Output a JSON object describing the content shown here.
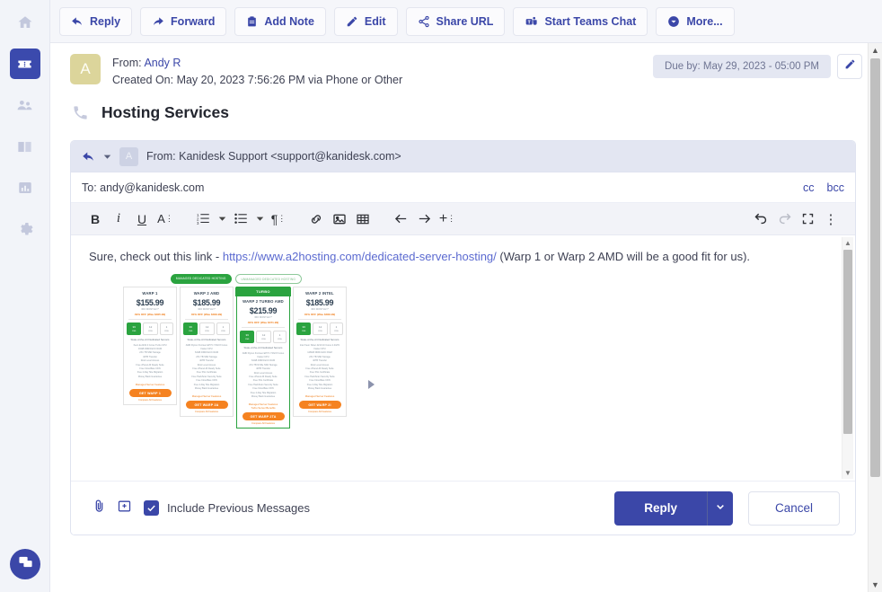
{
  "sidebar": {
    "items": [
      {
        "name": "home",
        "icon": "home-icon",
        "active": false
      },
      {
        "name": "tickets",
        "icon": "ticket-icon",
        "active": true
      },
      {
        "name": "contacts",
        "icon": "people-icon",
        "active": false
      },
      {
        "name": "knowledge-base",
        "icon": "book-icon",
        "active": false
      },
      {
        "name": "reports",
        "icon": "bar-chart-icon",
        "active": false
      },
      {
        "name": "settings",
        "icon": "gear-icon",
        "active": false
      }
    ],
    "fab": {
      "name": "chat-fab",
      "icon": "chat-bubble-icon"
    }
  },
  "toolbar": {
    "buttons": [
      {
        "label": "Reply",
        "icon": "reply-arrow-icon"
      },
      {
        "label": "Forward",
        "icon": "forward-arrow-icon"
      },
      {
        "label": "Add Note",
        "icon": "clipboard-icon"
      },
      {
        "label": "Edit",
        "icon": "pencil-icon"
      },
      {
        "label": "Share URL",
        "icon": "share-icon"
      },
      {
        "label": "Start Teams Chat",
        "icon": "teams-icon"
      },
      {
        "label": "More...",
        "icon": "circle-chevron-down-icon"
      }
    ]
  },
  "ticket": {
    "avatar_initial": "A",
    "from_label": "From:",
    "from_name": "Andy R",
    "created_line": "Created On: May 20, 2023 7:56:26 PM via Phone or Other",
    "due_pill": "Due by: May 29, 2023 - 05:00 PM",
    "due_edit_icon": "pencil-icon",
    "subject_icon": "phone-icon",
    "subject": "Hosting Services"
  },
  "reply": {
    "header": {
      "reply_icon": "reply-arrow-icon",
      "caret_icon": "caret-down-icon",
      "avatar_initial": "A",
      "from": "From: Kanidesk Support <support@kanidesk.com>"
    },
    "to_line": "To: andy@kanidesk.com",
    "cc_label": "cc",
    "bcc_label": "bcc",
    "editor_toolbar": [
      {
        "name": "bold-button",
        "glyph": "B",
        "dim": false
      },
      {
        "name": "italic-button",
        "glyph": "i",
        "dim": false
      },
      {
        "name": "underline-button",
        "glyph": "U",
        "dim": false
      },
      {
        "name": "font-style-button",
        "glyph": "A⋮",
        "dim": false
      },
      {
        "name": "ordered-list-button",
        "glyph": "ol",
        "dim": false
      },
      {
        "name": "ordered-list-caret",
        "glyph": "▾",
        "dim": false
      },
      {
        "name": "unordered-list-button",
        "glyph": "ul",
        "dim": false
      },
      {
        "name": "unordered-list-caret",
        "glyph": "▾",
        "dim": false
      },
      {
        "name": "paragraph-button",
        "glyph": "¶⋮",
        "dim": false
      },
      {
        "name": "link-button",
        "glyph": "link",
        "dim": false
      },
      {
        "name": "insert-image-button",
        "glyph": "image",
        "dim": false
      },
      {
        "name": "insert-table-button",
        "glyph": "table",
        "dim": false
      },
      {
        "name": "outdent-button",
        "glyph": "←",
        "dim": false
      },
      {
        "name": "indent-button",
        "glyph": "→",
        "dim": false
      },
      {
        "name": "insert-more-button",
        "glyph": "+⋮",
        "dim": false
      },
      {
        "name": "undo-button",
        "glyph": "undo",
        "dim": false
      },
      {
        "name": "redo-button",
        "glyph": "redo",
        "dim": true
      },
      {
        "name": "fullscreen-button",
        "glyph": "expand",
        "dim": false
      },
      {
        "name": "overflow-menu-button",
        "glyph": "⋮",
        "dim": false
      }
    ],
    "body": {
      "text_before": "Sure, check out this link - ",
      "link": "https://www.a2hosting.com/dedicated-server-hosting/",
      "text_after": " (Warp 1 or Warp 2 AMD will be a good fit for us)."
    },
    "footer": {
      "attach_icon": "paperclip-icon",
      "insert_icon": "insert-image-plus-icon",
      "checkbox_checked": true,
      "checkbox_label": "Include Previous Messages",
      "reply_label": "Reply",
      "reply_split_icon": "chevron-down-icon",
      "cancel_label": "Cancel"
    }
  },
  "embedded_image": {
    "name": "a2hosting-pricing-screenshot",
    "toggle_pills": [
      {
        "label": "MANAGED DEDICATED HOSTING",
        "selected": true
      },
      {
        "label": "UNMANAGED DEDICATED HOSTING",
        "selected": false
      }
    ],
    "turbo_badge": "TURBO",
    "plans": [
      {
        "name": "WARP 1",
        "price": "$155.99",
        "per": "/MO MONTHLY*",
        "save": "49% OFF (Was $305.99)",
        "terms": [
          "36 mo",
          "12 mo",
          "1 mo"
        ],
        "selected_term": 0,
        "highlight": false,
        "tagline": "State-of-the-Art Dedicated Servers",
        "features": [
          "Xeon E-2234 4 Cores Turbo CPU",
          "16GB DDR4 ECC RAM",
          "2X1 TB SSD Storage",
          "40TB Transfer",
          "Root Level Access",
          "Free cPanel All Ready Suite",
          "Free Cloudflare CDN",
          "Free 2-Day Site Migration",
          "Money Back Guarantee"
        ],
        "managed_label": "Managed Server Features",
        "button": "GET WARP 1",
        "compare": "Compare All Features"
      },
      {
        "name": "WARP 2 AMD",
        "price": "$185.99",
        "per": "/MO MONTHLY*",
        "save": "40% OFF (Was $309.99)",
        "terms": [
          "36 mo",
          "12 mo",
          "1 mo"
        ],
        "selected_term": 0,
        "highlight": false,
        "tagline": "State-of-the-Art Dedicated Servers",
        "features": [
          "AMD Ryzen 3rd-Gen EPYC 7232 8 Cores",
          "Faster CPU",
          "64GB DDR4 ECC RAM",
          "2X1 TB SSD Storage",
          "40TB Transfer",
          "Root Level Access",
          "Free cPanel All Ready Suite",
          "Free SSL Certificate",
          "Free HackScan Security Suite",
          "Free Cloudflare CDN",
          "Free 2-Day Site Migration",
          "Money Back Guarantee"
        ],
        "managed_label": "Managed Server Features",
        "button": "GET WARP 2A",
        "compare": "Compare All Features"
      },
      {
        "name": "WARP 2 TURBO AMD",
        "price": "$215.99",
        "per": "/MO MONTHLY*",
        "save": "40% OFF (Was $371.99)",
        "terms": [
          "36 mo",
          "12 mo",
          "1 mo"
        ],
        "selected_term": 0,
        "highlight": true,
        "tagline": "State-of-the-Art Dedicated Servers",
        "features": [
          "AMD Ryzen 3rd-Gen EPYC 7232 8 Cores",
          "Faster CPU",
          "64GB DDR4 ECC RAM",
          "2X1 TB NVMe SSD Storage",
          "40TB Transfer",
          "Root Level Access",
          "Free cPanel All Ready Suite",
          "Free SSL Certificate",
          "Free HackScan Security Suite",
          "Free Cloudflare CDN",
          "Free 2-Day Site Migration",
          "Money Back Guarantee"
        ],
        "managed_label": "Managed Server Features",
        "turbo_label": "Turbo Server Benefits",
        "button": "GET WARP 2TA",
        "compare": "Compare All Features"
      },
      {
        "name": "WARP 2 INTEL",
        "price": "$185.99",
        "per": "/MO MONTHLY*",
        "save": "40% OFF (Was $309.99)",
        "terms": [
          "36 mo",
          "12 mo",
          "1 mo"
        ],
        "selected_term": 0,
        "highlight": false,
        "tagline": "State-of-the-Art Dedicated Servers",
        "features": [
          "Intel Xeon Silver 4210 10 Cores 2.4GHz",
          "Faster CPU",
          "128GB DDR4 ECC RAM",
          "2X1 TB SSD Storage",
          "40TB Transfer",
          "Root Level Access",
          "Free cPanel All Ready Suite",
          "Free SSL Certificate",
          "Free HackScan Security Suite",
          "Free Cloudflare CDN",
          "Free 2-Day Site Migration",
          "Money Back Guarantee"
        ],
        "managed_label": "Managed Server Features",
        "button": "GET WARP 2I",
        "compare": "Compare All Features"
      }
    ],
    "carousel_next_icon": "triangle-right-icon"
  },
  "scrollbars": {
    "page": {
      "up": "▲",
      "down": "▼"
    },
    "editor": {
      "up": "▲",
      "down": "▼"
    }
  },
  "colors": {
    "accent": "#3b47a8",
    "link": "#5b6ad0",
    "avatar": "#dcd59b",
    "pricing_green": "#2aa33f",
    "pricing_orange": "#f58220"
  }
}
